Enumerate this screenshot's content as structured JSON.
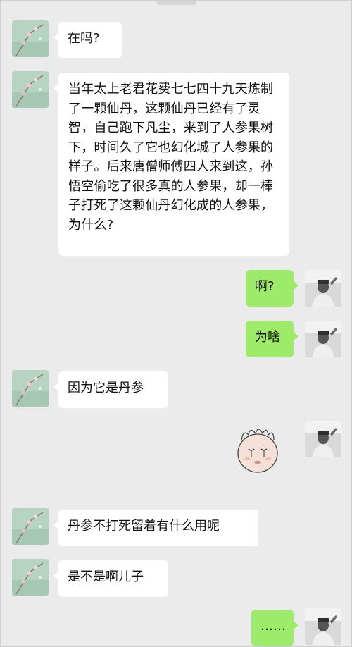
{
  "chat": {
    "messages": [
      {
        "side": "left",
        "text": "在吗?"
      },
      {
        "side": "left",
        "text": "当年太上老君花费七七四十九天炼制了一颗仙丹，这颗仙丹已经有了灵智，自己跑下凡尘，来到了人参果树下，时间久了它也幻化城了人参果的样子。后来唐僧师傅四人来到这，孙悟空偷吃了很多真的人参果，却一棒子打死了这颗仙丹幻化成的人参果，为什么?"
      },
      {
        "side": "right",
        "text": "啊?"
      },
      {
        "side": "right",
        "text": "为啥"
      },
      {
        "side": "left",
        "text": "因为它是丹参"
      },
      {
        "side": "right",
        "sticker": "crying-face-sticker"
      },
      {
        "side": "left",
        "text": "丹参不打死留着有什么用呢"
      },
      {
        "side": "left",
        "text": "是不是啊儿子"
      },
      {
        "side": "right",
        "text": "……"
      }
    ]
  },
  "colors": {
    "background": "#ebebeb",
    "left_bubble": "#ffffff",
    "right_bubble": "#9eea6a"
  },
  "icons": {
    "left_avatar": "flower-avatar",
    "right_avatar": "person-photo-avatar",
    "sticker": "crying-face-sticker"
  }
}
